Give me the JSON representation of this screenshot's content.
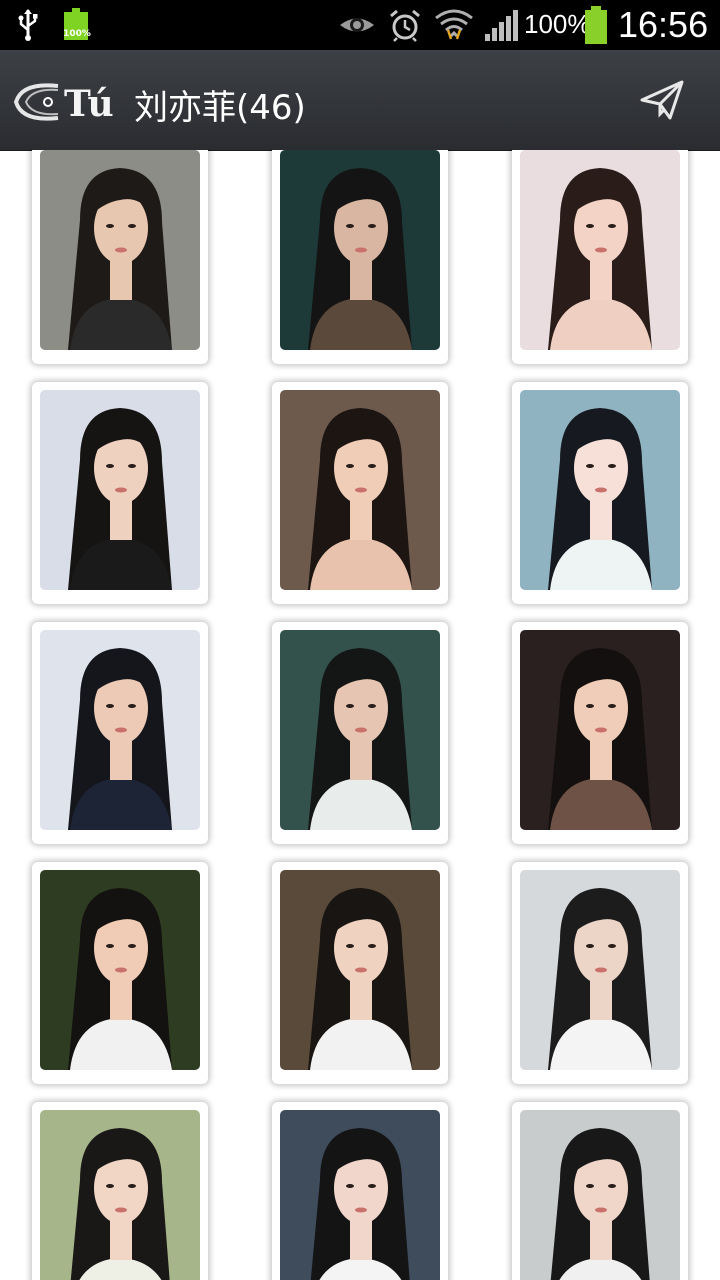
{
  "status_bar": {
    "small_battery_label": "100%",
    "battery_percent": "100%",
    "time": "16:56",
    "icons": [
      "usb-icon",
      "battery-icon",
      "eye-icon",
      "alarm-icon",
      "wifi-icon",
      "signal-icon",
      "battery-icon"
    ]
  },
  "action_bar": {
    "logo_text": "Tú",
    "title": "刘亦菲(46)",
    "share_icon": "send-icon"
  },
  "gallery": {
    "photos": [
      {
        "bg": "#8c8d86",
        "skin": "#e8c7b0",
        "hair": "#1e1a18",
        "cloth": "#2a2a2a"
      },
      {
        "bg": "#1d3a38",
        "skin": "#d9b6a2",
        "hair": "#141414",
        "cloth": "#5b4a3c"
      },
      {
        "bg": "#e9dde0",
        "skin": "#f3d3c6",
        "hair": "#2a1c18",
        "cloth": "#f0cfc3"
      },
      {
        "bg": "#d8dde8",
        "skin": "#efd1c0",
        "hair": "#161313",
        "cloth": "#1a1a1a"
      },
      {
        "bg": "#6d5a4d",
        "skin": "#f0cdb6",
        "hair": "#1c1512",
        "cloth": "#e9c2ad"
      },
      {
        "bg": "#8fb3c0",
        "skin": "#f6e0d8",
        "hair": "#161a20",
        "cloth": "#eef3f4"
      },
      {
        "bg": "#dfe3ec",
        "skin": "#eccab6",
        "hair": "#14161c",
        "cloth": "#1c2436"
      },
      {
        "bg": "#33524c",
        "skin": "#e6c6b3",
        "hair": "#141615",
        "cloth": "#e8ecea"
      },
      {
        "bg": "#2a2020",
        "skin": "#efcdb8",
        "hair": "#151010",
        "cloth": "#6e5246"
      },
      {
        "bg": "#2e3d22",
        "skin": "#f0cbb6",
        "hair": "#141210",
        "cloth": "#f1f1f1"
      },
      {
        "bg": "#5a4a3a",
        "skin": "#efd2bf",
        "hair": "#191512",
        "cloth": "#f2f2f2"
      },
      {
        "bg": "#d6d9dc",
        "skin": "#ecd4c6",
        "hair": "#1c1c1c",
        "cloth": "#f4f4f4"
      },
      {
        "bg": "#a6b58a",
        "skin": "#f1d6c6",
        "hair": "#1a1816",
        "cloth": "#eef0e6"
      },
      {
        "bg": "#3e4c5c",
        "skin": "#f1d6cb",
        "hair": "#141414",
        "cloth": "#f4f4f4"
      },
      {
        "bg": "#c9cccd",
        "skin": "#efd6c9",
        "hair": "#181818",
        "cloth": "#f0f0f0"
      }
    ]
  }
}
